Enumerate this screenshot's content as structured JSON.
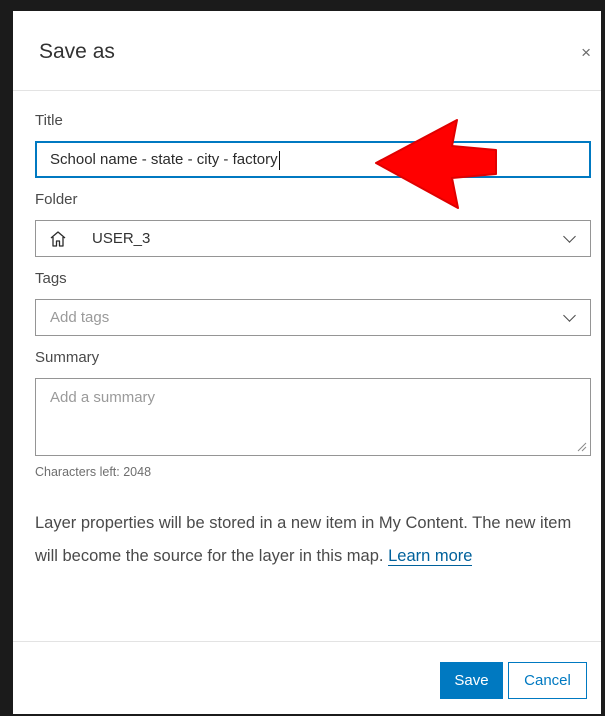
{
  "dialog": {
    "title": "Save as",
    "close_label": "×"
  },
  "form": {
    "title_label": "Title",
    "title_value": "School name - state - city - factory",
    "folder_label": "Folder",
    "folder_value": "USER_3",
    "tags_label": "Tags",
    "tags_placeholder": "Add tags",
    "summary_label": "Summary",
    "summary_placeholder": "Add a summary",
    "characters_left": "Characters left: 2048"
  },
  "info": {
    "text": "Layer properties will be stored in a new item in My Content. The new item will become the source for the layer in this map.",
    "link_text": "Learn more"
  },
  "footer": {
    "save_label": "Save",
    "cancel_label": "Cancel"
  },
  "icons": {
    "folder": "home-icon",
    "dropdown": "chevron-down-icon",
    "annotation": "red-arrow-icon"
  },
  "colors": {
    "accent": "#0079c1",
    "annotation": "#ff0000"
  }
}
